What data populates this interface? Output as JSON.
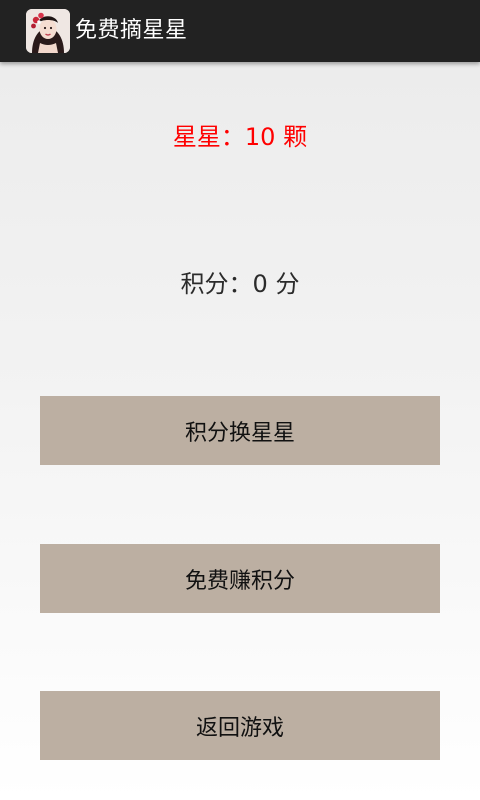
{
  "app_bar": {
    "title": "免费摘星星",
    "icon": "app-avatar-icon"
  },
  "stats": {
    "stars_text": "星星：10 颗",
    "score_text": "积分：0 分"
  },
  "buttons": {
    "exchange_label": "积分换星星",
    "earn_label": "免费赚积分",
    "back_label": "返回游戏"
  },
  "colors": {
    "action_bar": "#222222",
    "stars_text": "#ff0000",
    "button_bg": "#bcafa2"
  }
}
